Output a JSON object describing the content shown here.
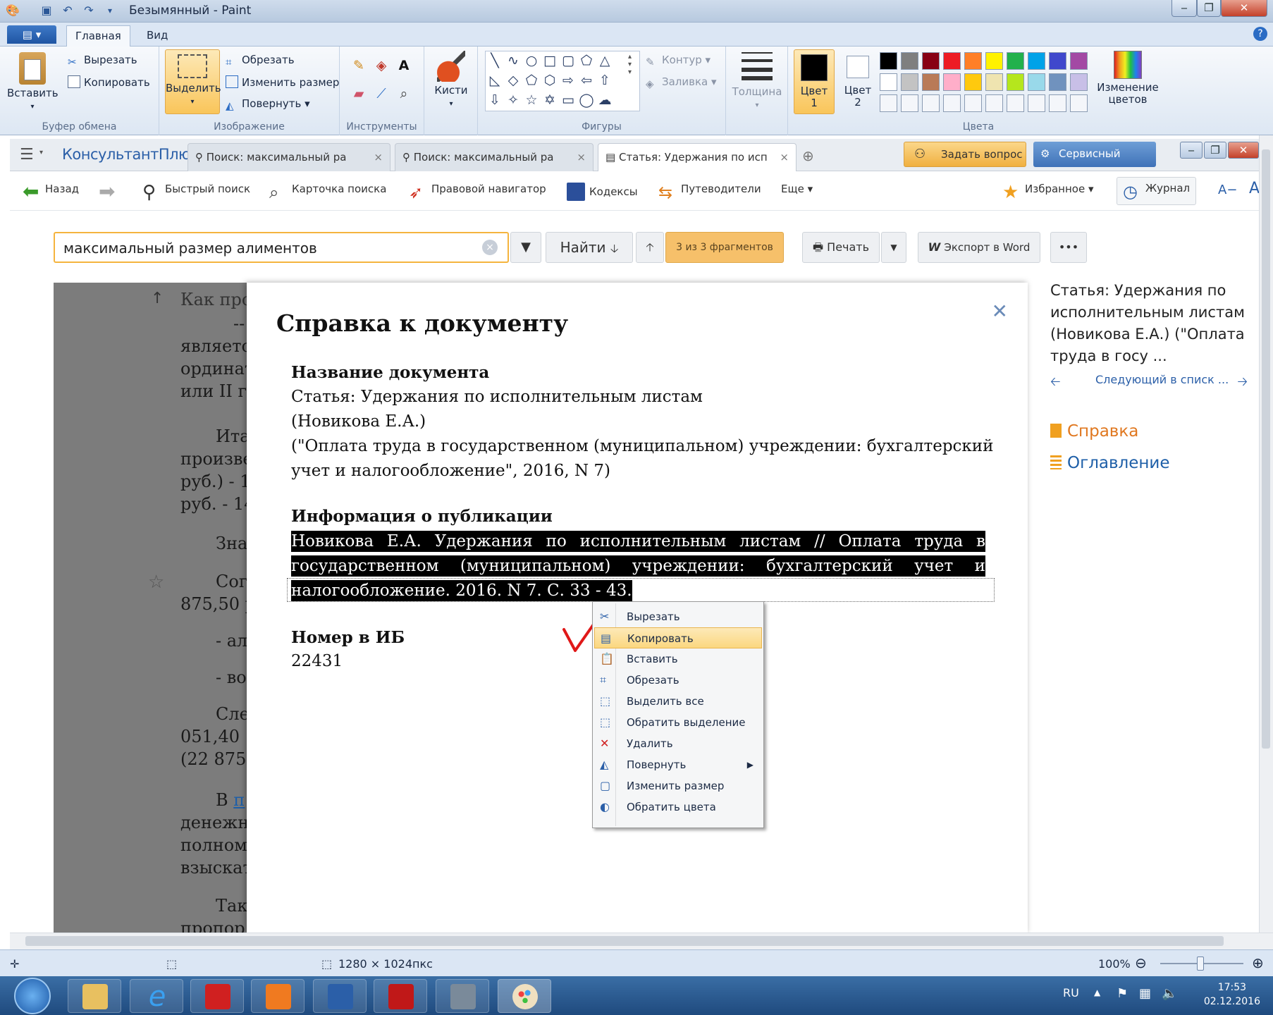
{
  "paint": {
    "window_title": "Безымянный - Paint",
    "tabs": [
      "Главная",
      "Вид"
    ],
    "clipboard": {
      "paste": "Вставить",
      "cut": "Вырезать",
      "copy": "Копировать",
      "label": "Буфер обмена"
    },
    "image": {
      "select": "Выделить",
      "crop": "Обрезать",
      "resize": "Изменить размер",
      "rotate": "Повернуть",
      "label": "Изображение"
    },
    "tools_label": "Инструменты",
    "brushes": "Кисти",
    "shapes": {
      "outline": "Контур",
      "fill": "Заливка",
      "label": "Фигуры"
    },
    "thickness": "Толщина",
    "colors": {
      "color1": "Цвет\n1",
      "color2": "Цвет\n2",
      "edit": "Изменение\nцветов",
      "label": "Цвета",
      "row1": [
        "#000000",
        "#7f7f7f",
        "#880015",
        "#ed1c24",
        "#ff7f27",
        "#fff200",
        "#22b14c",
        "#00a2e8",
        "#3f48cc",
        "#a349a4"
      ],
      "row2": [
        "#ffffff",
        "#c3c3c3",
        "#b97a57",
        "#ffaec9",
        "#ffc90e",
        "#efe4b0",
        "#b5e61d",
        "#99d9ea",
        "#7092be",
        "#c8bfe7"
      ]
    },
    "status": {
      "size": "1280 × 1024пкс",
      "zoom": "100%"
    }
  },
  "consultant": {
    "logo": "КонсультантПлюс",
    "tabs": [
      {
        "label": "Поиск: максимальный ра"
      },
      {
        "label": "Поиск: максимальный ра"
      },
      {
        "label": "Статья: Удержания по исп"
      }
    ],
    "ask": "Задать вопрос",
    "service": "Сервисный центр",
    "toolbar": {
      "back": "Назад",
      "quick_search": "Быстрый поиск",
      "search_card": "Карточка поиска",
      "legal_nav": "Правовой навигатор",
      "codes": "Кодексы",
      "guides": "Путеводители",
      "more": "Еще",
      "favorites": "Избранное",
      "journal": "Журнал",
      "font_small": "A−",
      "font_big": "A"
    },
    "search": {
      "value": "максимальный размер алиментов",
      "find": "Найти",
      "found": "3 из 3 фрагментов",
      "print": "Печать",
      "export": "Экспорт в Word",
      "more": "•••"
    },
    "doc_bg_lines": [
      "Как про",
      "--",
      "являетс",
      "ординат",
      "или II г",
      "Ита",
      "произве",
      "руб.) - 1",
      "руб. - 14",
      "Зна",
      "Сог",
      "875,50 р",
      "- ал",
      "- во",
      "Сле",
      "051,40",
      "(22 875,",
      "В п",
      "денежн",
      "полном",
      "взыскат",
      "Так",
      "пропор"
    ],
    "dialog": {
      "title": "Справка к документу",
      "doc_name_h": "Название документа",
      "doc_name_lines": [
        "Статья: Удержания по исполнительным листам",
        "(Новикова Е.А.)",
        "(\"Оплата труда в государственном (муниципальном) учреждении: бухгалтерский",
        "учет и налогообложение\", 2016, N 7)"
      ],
      "pub_h": "Информация о публикации",
      "pub_lines": [
        "Новикова Е.А. Удержания по исполнительным листам // Оплата труда в",
        "государственном (муниципальном) учреждении: бухгалтерский учет и",
        "налогообложение. 2016. N 7. С. 33 - 43."
      ],
      "ib_h": "Номер в ИБ",
      "ib_value": "22431"
    },
    "right_panel": {
      "title": "Статья: Удержания по исполнительным листам (Новикова Е.А.) (\"Оплата труда в госу ...",
      "next": "Следующий в списк ...",
      "help": "Справка",
      "toc": "Оглавление"
    }
  },
  "context_menu": [
    {
      "label": "Вырезать",
      "icon": "scissors-icon"
    },
    {
      "label": "Копировать",
      "icon": "copy-icon",
      "highlighted": true
    },
    {
      "label": "Вставить",
      "icon": "paste-icon"
    },
    {
      "label": "Обрезать",
      "icon": "crop-icon"
    },
    {
      "label": "Выделить все",
      "icon": "select-all-icon"
    },
    {
      "label": "Обратить выделение",
      "icon": "invert-selection-icon"
    },
    {
      "label": "Удалить",
      "icon": "delete-icon"
    },
    {
      "label": "Повернуть",
      "icon": "rotate-icon",
      "submenu": true
    },
    {
      "label": "Изменить размер",
      "icon": "resize-icon"
    },
    {
      "label": "Обратить цвета",
      "icon": "invert-colors-icon"
    }
  ],
  "taskbar": {
    "lang": "RU",
    "time": "17:53",
    "date": "02.12.2016"
  }
}
